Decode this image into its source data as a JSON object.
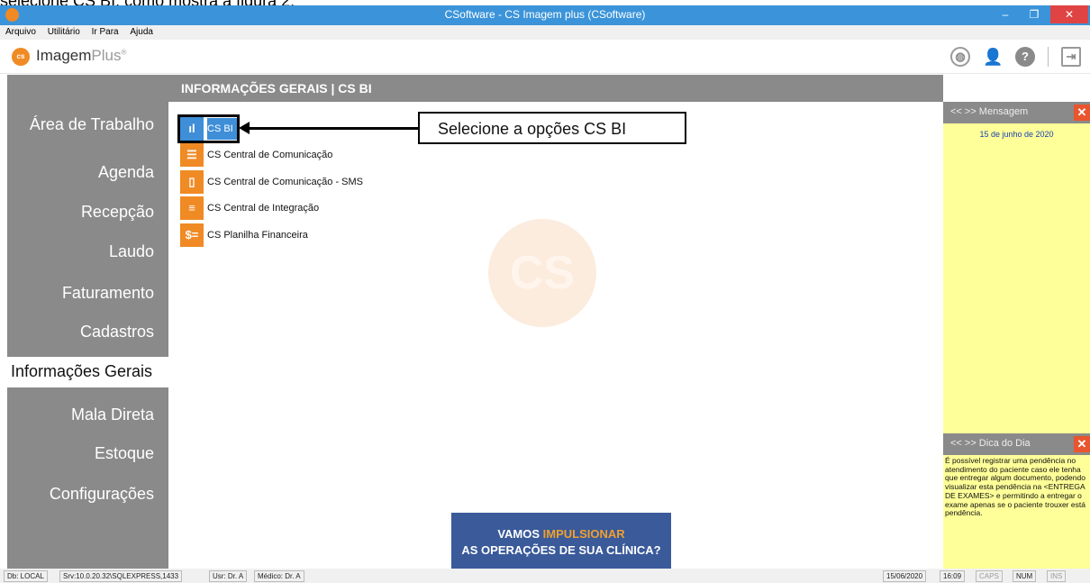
{
  "doc_caption": "selecione CS BI, como mostra a figura 2:",
  "window": {
    "title": "CSoftware - CS Imagem plus (CSoftware)",
    "minimize": "–",
    "maximize": "❐",
    "close": "✕"
  },
  "menu": [
    "Arquivo",
    "Utilitário",
    "Ir Para",
    "Ajuda"
  ],
  "brand": {
    "logo": "cs",
    "name": "Imagem",
    "plus": "Plus",
    "mark": "®"
  },
  "toolbar_icons": [
    "globe-icon",
    "user-icon",
    "help-icon",
    "exit-icon"
  ],
  "sidebar": {
    "items": [
      {
        "label": "Área de Trabalho"
      },
      {
        "label": "Agenda"
      },
      {
        "label": "Recepção"
      },
      {
        "label": "Laudo"
      },
      {
        "label": "Faturamento"
      },
      {
        "label": "Cadastros"
      },
      {
        "label": "Informações Gerais",
        "active": true
      },
      {
        "label": "Mala Direta"
      },
      {
        "label": "Estoque"
      },
      {
        "label": "Configurações"
      }
    ]
  },
  "content": {
    "header": "INFORMAÇÕES GERAIS | CS BI",
    "watermark": "CS",
    "items": [
      {
        "label": "CS BI",
        "icon": "bar-chart-icon",
        "selected": true
      },
      {
        "label": "CS Central de Comunicação",
        "icon": "communication-icon"
      },
      {
        "label": "CS Central de Comunicação - SMS",
        "icon": "phone-icon"
      },
      {
        "label": "CS Central de Integração",
        "icon": "database-icon"
      },
      {
        "label": "CS Planilha Financeira",
        "icon": "money-icon"
      }
    ],
    "callout": "Selecione a opções CS BI",
    "banner": {
      "line1_pre": "VAMOS ",
      "line1_highlight": "IMPULSIONAR",
      "line2": "AS OPERAÇÕES DE SUA CLÍNICA?"
    }
  },
  "message_panel": {
    "nav": "<<   >> Mensagem",
    "date": "15 de junho de 2020"
  },
  "tip_panel": {
    "nav": "<<   >> Dica do Dia",
    "text": "É possível registrar uma pendência no atendimento do paciente caso ele tenha que entregar algum documento, podendo visualizar esta pendência na <ENTREGA DE EXAMES> e permitindo a entregar o exame apenas se o paciente trouxer está pendência."
  },
  "statusbar": {
    "db": "Db: LOCAL",
    "srv": "Srv:10.0.20.32\\SQLEXPRESS,1433",
    "usr": "Usr: Dr. A",
    "medico": "Médico: Dr. A",
    "date": "15/06/2020",
    "time": "16:09",
    "caps": "CAPS",
    "num": "NUM",
    "ins": "INS"
  },
  "colors": {
    "accent_orange": "#f08a24",
    "selected_blue": "#3e8ed8",
    "sidebar_gray": "#8a8a8a",
    "panel_yellow": "#ffff99",
    "banner_blue": "#3a5a9a"
  }
}
